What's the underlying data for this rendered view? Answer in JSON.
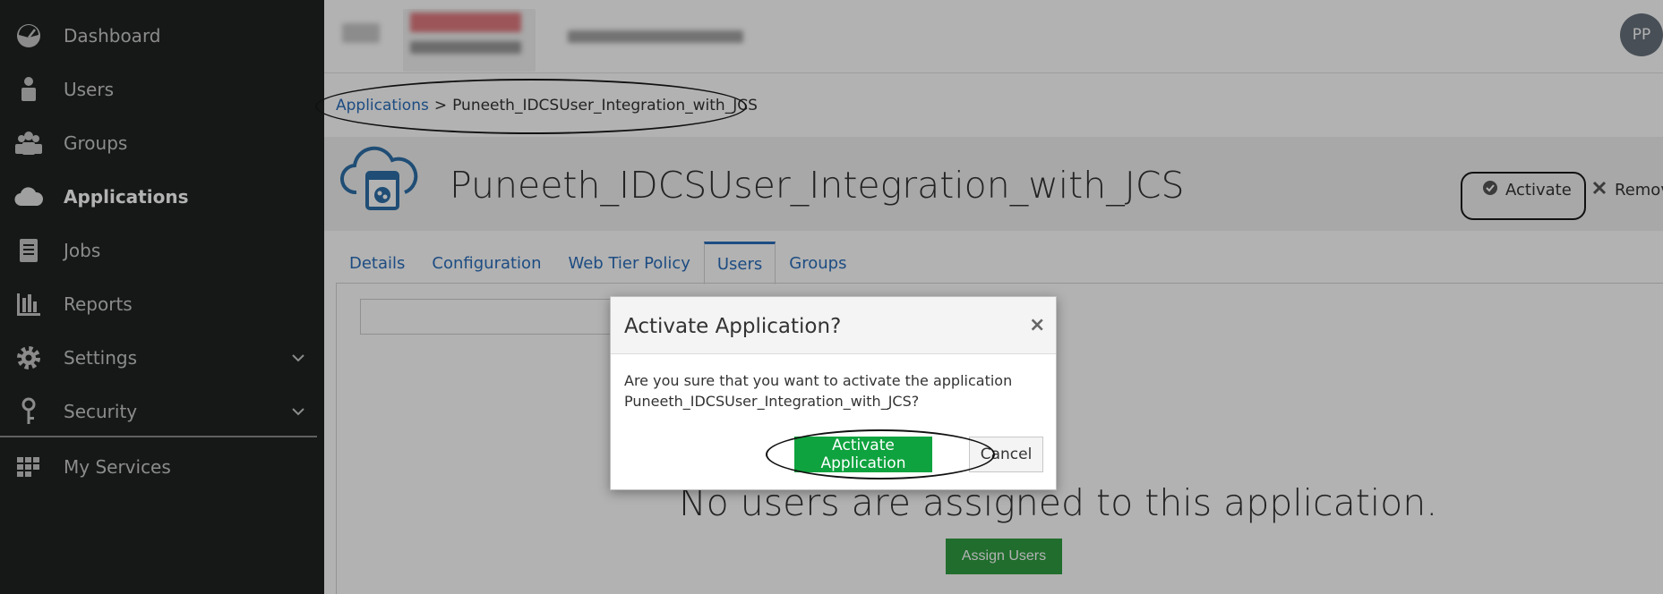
{
  "sidebar": {
    "items": [
      {
        "label": "Dashboard",
        "icon": "dashboard-icon"
      },
      {
        "label": "Users",
        "icon": "user-icon"
      },
      {
        "label": "Groups",
        "icon": "groups-icon"
      },
      {
        "label": "Applications",
        "icon": "cloud-icon",
        "active": true
      },
      {
        "label": "Jobs",
        "icon": "jobs-icon"
      },
      {
        "label": "Reports",
        "icon": "bar-chart-icon"
      },
      {
        "label": "Settings",
        "icon": "gear-icon",
        "expandable": true
      },
      {
        "label": "Security",
        "icon": "key-icon",
        "expandable": true
      },
      {
        "label": "My Services",
        "icon": "grid-icon"
      }
    ]
  },
  "topbar": {
    "avatar_initials": "PP"
  },
  "breadcrumb": {
    "root": "Applications",
    "separator": ">",
    "current": "Puneeth_IDCSUser_Integration_with_JCS"
  },
  "app": {
    "title": "Puneeth_IDCSUser_Integration_with_JCS",
    "activate_label": "Activate",
    "remove_label": "Remove"
  },
  "tabs": [
    {
      "label": "Details"
    },
    {
      "label": "Configuration"
    },
    {
      "label": "Web Tier Policy"
    },
    {
      "label": "Users",
      "active": true
    },
    {
      "label": "Groups"
    }
  ],
  "users_tab": {
    "empty_message": "No users are assigned to this application.",
    "assign_button": "Assign Users"
  },
  "dialog": {
    "title": "Activate Application?",
    "close": "×",
    "body_line1": "Are you sure that you want to activate the application",
    "body_line2": "Puneeth_IDCSUser_Integration_with_JCS?",
    "confirm_button": "Activate Application",
    "cancel_button": "Cancel"
  },
  "colors": {
    "sidebar_bg": "#202222",
    "link_blue": "#2a6ebb",
    "primary_green": "#0fa33f",
    "app_icon_blue": "#2d6fa8"
  }
}
